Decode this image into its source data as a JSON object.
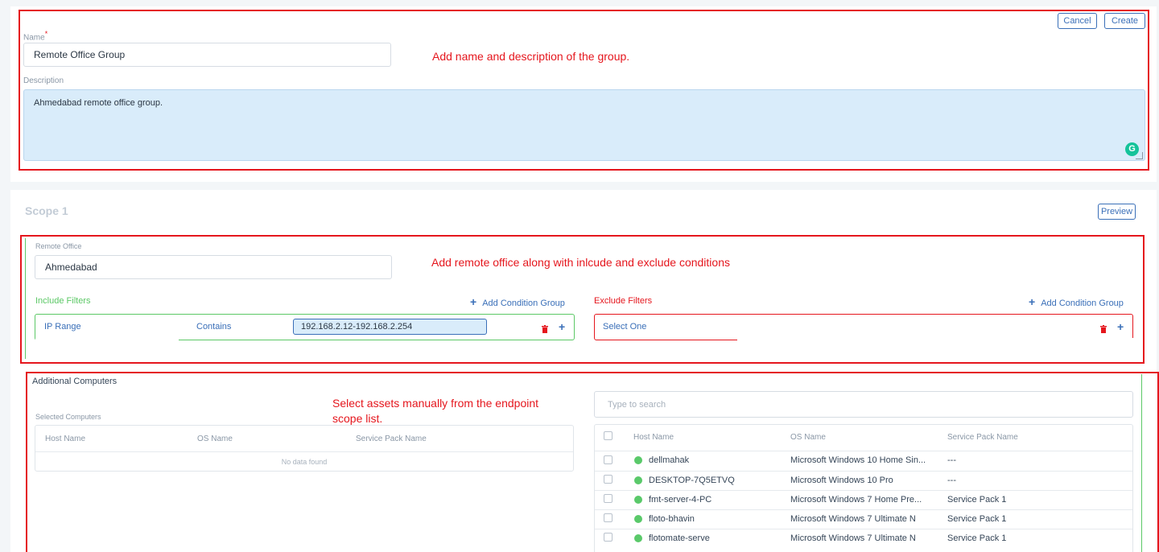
{
  "header": {
    "cancel_label": "Cancel",
    "create_label": "Create"
  },
  "group": {
    "name_label": "Name",
    "required_mark": "*",
    "name_value": "Remote Office Group",
    "description_label": "Description",
    "description_value": "Ahmedabad remote office group."
  },
  "scope": {
    "title": "Scope 1",
    "preview_label": "Preview",
    "remote_office_label": "Remote Office",
    "remote_office_value": "Ahmedabad",
    "include": {
      "title": "Include Filters",
      "add_label": "Add Condition Group",
      "field": "IP Range",
      "operator": "Contains",
      "value": "192.168.2.12-192.168.2.254"
    },
    "exclude": {
      "title": "Exclude Filters",
      "add_label": "Add Condition Group",
      "placeholder": "Select One"
    }
  },
  "additional": {
    "title": "Additional Computers",
    "selected_label": "Selected Computers",
    "columns": [
      "Host Name",
      "OS Name",
      "Service Pack Name"
    ],
    "empty_text": "No data found",
    "search_placeholder": "Type to search",
    "rows": [
      {
        "host": "dellmahak",
        "os": "Microsoft Windows 10 Home Sin...",
        "sp": "---"
      },
      {
        "host": "DESKTOP-7Q5ETVQ",
        "os": "Microsoft Windows 10 Pro",
        "sp": "---"
      },
      {
        "host": "fmt-server-4-PC",
        "os": "Microsoft Windows 7 Home Pre...",
        "sp": "Service Pack 1"
      },
      {
        "host": "floto-bhavin",
        "os": "Microsoft Windows 7 Ultimate N",
        "sp": "Service Pack 1"
      },
      {
        "host": "flotomate-serve",
        "os": "Microsoft Windows 7 Ultimate N",
        "sp": "Service Pack 1"
      }
    ]
  },
  "annotations": {
    "a1": "Add name and description of the group.",
    "a2": "Add remote office along with inlcude and exclude conditions",
    "a3_line1": "Select assets manually from the endpoint",
    "a3_line2": "scope list."
  },
  "colors": {
    "accent": "#3a6fb8",
    "include": "#5cc866",
    "exclude": "#e5161d",
    "annotation": "#e5161d",
    "online": "#5ac96a"
  }
}
